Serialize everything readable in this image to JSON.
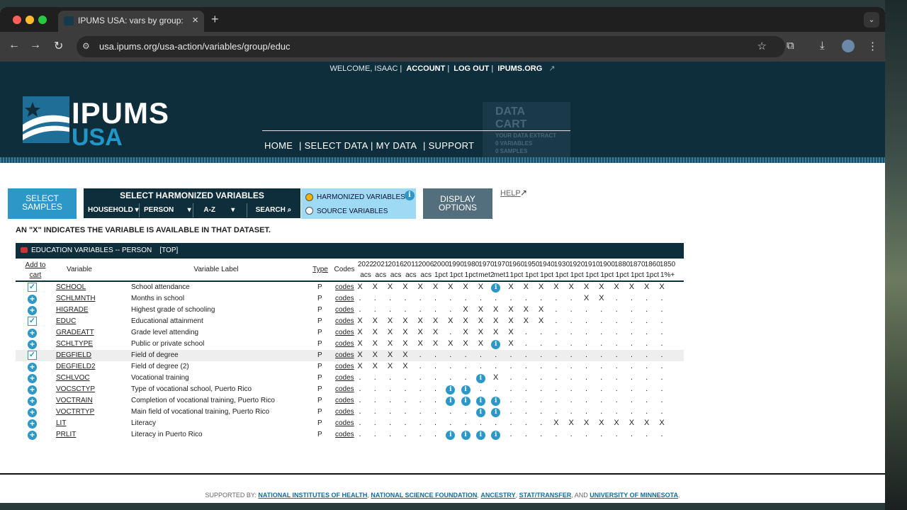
{
  "browser": {
    "tab_title": "IPUMS USA: vars by group: e",
    "url": "usa.ipums.org/usa-action/variables/group/educ"
  },
  "util_bar": {
    "welcome": "WELCOME, ISAAC",
    "account": "ACCOUNT",
    "logout": "LOG OUT",
    "ipums_org": "IPUMS.ORG"
  },
  "logo": {
    "line1": "IPUMS",
    "line2": "USA"
  },
  "nav": {
    "home": "HOME",
    "select_data": "| SELECT DATA",
    "my_data": "| MY DATA",
    "support": "| SUPPORT"
  },
  "cart": {
    "title": "DATA CART",
    "sub1": "YOUR DATA EXTRACT",
    "sub2": "0 VARIABLES",
    "sub3": "0 SAMPLES"
  },
  "controls": {
    "select_samples": "SELECT SAMPLES",
    "select_harmonized": "SELECT HARMONIZED VARIABLES",
    "dropdowns": [
      "HOUSEHOLD",
      "PERSON",
      "A-Z",
      "SEARCH"
    ],
    "radio_harmonized": "HARMONIZED VARIABLES",
    "radio_source": "SOURCE VARIABLES",
    "display_options": "DISPLAY OPTIONS",
    "help": "HELP"
  },
  "note": "AN \"X\" INDICATES THE VARIABLE IS AVAILABLE IN THAT DATASET.",
  "table": {
    "title": "EDUCATION VARIABLES -- PERSON",
    "top_link": "[TOP]",
    "col_add": "Add to cart",
    "col_variable": "Variable",
    "col_label": "Variable Label",
    "col_type": "Type",
    "col_codes": "Codes",
    "years": [
      "2022",
      "2021",
      "2016",
      "2011",
      "2006",
      "2000",
      "1990",
      "1980",
      "1970",
      "1970",
      "1960",
      "1950",
      "1940",
      "1930",
      "1920",
      "1910",
      "1900",
      "1880",
      "1870",
      "1860",
      "1850"
    ],
    "samples": [
      "acs",
      "acs",
      "acs",
      "acs",
      "acs",
      "1pct",
      "1pct",
      "1pct",
      "met2",
      "met1",
      "1pct",
      "1pct",
      "1pct",
      "1pct",
      "1pct",
      "1pct",
      "1pct",
      "1pct",
      "1pct",
      "1pct",
      "1%+"
    ],
    "rows": [
      {
        "name": "SCHOOL",
        "label": "School attendance",
        "type": "P",
        "codes": "codes",
        "added": true,
        "marks": [
          "X",
          "X",
          "X",
          "X",
          "X",
          "X",
          "X",
          "X",
          "X",
          "i",
          "X",
          "X",
          "X",
          "X",
          "X",
          "X",
          "X",
          "X",
          "X",
          "X",
          "X"
        ]
      },
      {
        "name": "SCHLMNTH",
        "label": "Months in school",
        "type": "P",
        "codes": "codes",
        "added": false,
        "marks": [
          ".",
          ".",
          ".",
          ".",
          ".",
          ".",
          ".",
          ".",
          ".",
          ".",
          ".",
          ".",
          ".",
          ".",
          ".",
          "X",
          "X",
          ".",
          ".",
          ".",
          "."
        ]
      },
      {
        "name": "HIGRADE",
        "label": "Highest grade of schooling",
        "type": "P",
        "codes": "codes",
        "added": false,
        "marks": [
          ".",
          ".",
          ".",
          ".",
          ".",
          ".",
          ".",
          "X",
          "X",
          "X",
          "X",
          "X",
          "X",
          ".",
          ".",
          ".",
          ".",
          ".",
          ".",
          ".",
          "."
        ]
      },
      {
        "name": "EDUC",
        "label": "Educational attainment",
        "type": "P",
        "codes": "codes",
        "added": true,
        "marks": [
          "X",
          "X",
          "X",
          "X",
          "X",
          "X",
          "X",
          "X",
          "X",
          "X",
          "X",
          "X",
          "X",
          ".",
          ".",
          ".",
          ".",
          ".",
          ".",
          ".",
          "."
        ]
      },
      {
        "name": "GRADEATT",
        "label": "Grade level attending",
        "type": "P",
        "codes": "codes",
        "added": false,
        "marks": [
          "X",
          "X",
          "X",
          "X",
          "X",
          "X",
          ".",
          "X",
          "X",
          "X",
          "X",
          ".",
          ".",
          ".",
          ".",
          ".",
          ".",
          ".",
          ".",
          ".",
          "."
        ]
      },
      {
        "name": "SCHLTYPE",
        "label": "Public or private school",
        "type": "P",
        "codes": "codes",
        "added": false,
        "marks": [
          "X",
          "X",
          "X",
          "X",
          "X",
          "X",
          "X",
          "X",
          "X",
          "i",
          "X",
          ".",
          ".",
          ".",
          ".",
          ".",
          ".",
          ".",
          ".",
          ".",
          "."
        ]
      },
      {
        "name": "DEGFIELD",
        "label": "Field of degree",
        "type": "P",
        "codes": "codes",
        "added": true,
        "marks": [
          "X",
          "X",
          "X",
          "X",
          ".",
          ".",
          ".",
          ".",
          ".",
          ".",
          ".",
          ".",
          ".",
          ".",
          ".",
          ".",
          ".",
          ".",
          ".",
          ".",
          "."
        ]
      },
      {
        "name": "DEGFIELD2",
        "label": "Field of degree (2)",
        "type": "P",
        "codes": "codes",
        "added": false,
        "marks": [
          "X",
          "X",
          "X",
          "X",
          ".",
          ".",
          ".",
          ".",
          ".",
          ".",
          ".",
          ".",
          ".",
          ".",
          ".",
          ".",
          ".",
          ".",
          ".",
          ".",
          "."
        ]
      },
      {
        "name": "SCHLVOC",
        "label": "Vocational training",
        "type": "P",
        "codes": "codes",
        "added": false,
        "marks": [
          ".",
          ".",
          ".",
          ".",
          ".",
          ".",
          ".",
          ".",
          "i",
          "X",
          ".",
          ".",
          ".",
          ".",
          ".",
          ".",
          ".",
          ".",
          ".",
          ".",
          "."
        ]
      },
      {
        "name": "VOCSCTYP",
        "label": "Type of vocational school, Puerto Rico",
        "type": "P",
        "codes": "codes",
        "added": false,
        "marks": [
          ".",
          ".",
          ".",
          ".",
          ".",
          ".",
          "i",
          "i",
          ".",
          ".",
          ".",
          ".",
          ".",
          ".",
          ".",
          ".",
          ".",
          ".",
          ".",
          ".",
          "."
        ]
      },
      {
        "name": "VOCTRAIN",
        "label": "Completion of vocational training, Puerto Rico",
        "type": "P",
        "codes": "codes",
        "added": false,
        "marks": [
          ".",
          ".",
          ".",
          ".",
          ".",
          ".",
          "i",
          "i",
          "i",
          "i",
          ".",
          ".",
          ".",
          ".",
          ".",
          ".",
          ".",
          ".",
          ".",
          ".",
          "."
        ]
      },
      {
        "name": "VOCTRTYP",
        "label": "Main field of vocational training, Puerto Rico",
        "type": "P",
        "codes": "codes",
        "added": false,
        "marks": [
          ".",
          ".",
          ".",
          ".",
          ".",
          ".",
          ".",
          ".",
          "i",
          "i",
          ".",
          ".",
          ".",
          ".",
          ".",
          ".",
          ".",
          ".",
          ".",
          ".",
          "."
        ]
      },
      {
        "name": "LIT",
        "label": "Literacy",
        "type": "P",
        "codes": "codes",
        "added": false,
        "marks": [
          ".",
          ".",
          ".",
          ".",
          ".",
          ".",
          ".",
          ".",
          ".",
          ".",
          ".",
          ".",
          ".",
          "X",
          "X",
          "X",
          "X",
          "X",
          "X",
          "X",
          "X"
        ]
      },
      {
        "name": "PRLIT",
        "label": "Literacy in Puerto Rico",
        "type": "P",
        "codes": "codes",
        "added": false,
        "marks": [
          ".",
          ".",
          ".",
          ".",
          ".",
          ".",
          "i",
          "i",
          "i",
          "i",
          ".",
          ".",
          ".",
          ".",
          ".",
          ".",
          ".",
          ".",
          ".",
          ".",
          "."
        ]
      }
    ]
  },
  "footer": {
    "prefix": "SUPPORTED BY:",
    "sponsors": [
      "NATIONAL INSTITUTES OF HEALTH",
      "NATIONAL SCIENCE FOUNDATION",
      "ANCESTRY",
      "STAT/TRANSFER"
    ],
    "and": ", AND",
    "last": "UNIVERSITY OF MINNESOTA"
  },
  "colors": {
    "brand_dark": "#0e2e3c",
    "accent_blue": "#2d98c8",
    "radio_bg": "#9fdaf5"
  }
}
